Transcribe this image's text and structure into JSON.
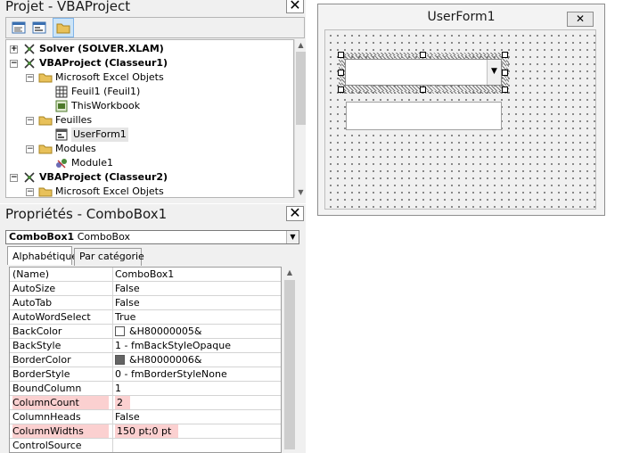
{
  "project_explorer": {
    "title": "Projet - VBAProject",
    "tree": [
      {
        "label": "Solver (SOLVER.XLAM)",
        "level": 0,
        "expander": "+",
        "icon": "vba-project-icon",
        "bold": true
      },
      {
        "label": "VBAProject (Classeur1)",
        "level": 0,
        "expander": "−",
        "icon": "vba-project-icon",
        "bold": true
      },
      {
        "label": "Microsoft Excel Objets",
        "level": 1,
        "expander": "−",
        "icon": "folder-icon",
        "bold": false
      },
      {
        "label": "Feuil1 (Feuil1)",
        "level": 2,
        "expander": "",
        "icon": "sheet-icon",
        "bold": false
      },
      {
        "label": "ThisWorkbook",
        "level": 2,
        "expander": "",
        "icon": "workbook-icon",
        "bold": false
      },
      {
        "label": "Feuilles",
        "level": 1,
        "expander": "−",
        "icon": "folder-icon",
        "bold": false
      },
      {
        "label": "UserForm1",
        "level": 2,
        "expander": "",
        "icon": "userform-icon",
        "bold": false,
        "selected": true
      },
      {
        "label": "Modules",
        "level": 1,
        "expander": "−",
        "icon": "folder-icon",
        "bold": false
      },
      {
        "label": "Module1",
        "level": 2,
        "expander": "",
        "icon": "module-icon",
        "bold": false
      },
      {
        "label": "VBAProject (Classeur2)",
        "level": 0,
        "expander": "−",
        "icon": "vba-project-icon",
        "bold": true
      },
      {
        "label": "Microsoft Excel Objets",
        "level": 1,
        "expander": "−",
        "icon": "folder-icon",
        "bold": false
      }
    ]
  },
  "properties": {
    "title": "Propriétés - ComboBox1",
    "object_name": "ComboBox1",
    "object_type": "ComboBox",
    "tabs": [
      {
        "label": "Alphabétique",
        "active": true
      },
      {
        "label": "Par catégorie",
        "active": false
      }
    ],
    "rows": [
      {
        "name": "(Name)",
        "value": "ComboBox1",
        "swatch": null,
        "highlight": false
      },
      {
        "name": "AutoSize",
        "value": "False",
        "swatch": null,
        "highlight": false
      },
      {
        "name": "AutoTab",
        "value": "False",
        "swatch": null,
        "highlight": false
      },
      {
        "name": "AutoWordSelect",
        "value": "True",
        "swatch": null,
        "highlight": false
      },
      {
        "name": "BackColor",
        "value": "&H80000005&",
        "swatch": "#ffffff",
        "highlight": false
      },
      {
        "name": "BackStyle",
        "value": "1 - fmBackStyleOpaque",
        "swatch": null,
        "highlight": false
      },
      {
        "name": "BorderColor",
        "value": "&H80000006&",
        "swatch": "#646464",
        "highlight": false
      },
      {
        "name": "BorderStyle",
        "value": "0 - fmBorderStyleNone",
        "swatch": null,
        "highlight": false
      },
      {
        "name": "BoundColumn",
        "value": "1",
        "swatch": null,
        "highlight": false
      },
      {
        "name": "ColumnCount",
        "value": "2",
        "swatch": null,
        "highlight": true
      },
      {
        "name": "ColumnHeads",
        "value": "False",
        "swatch": null,
        "highlight": false
      },
      {
        "name": "ColumnWidths",
        "value": "150 pt;0 pt",
        "swatch": null,
        "highlight": true
      },
      {
        "name": "ControlSource",
        "value": "",
        "swatch": null,
        "highlight": false
      }
    ],
    "highlight_color": "#fbd0d0"
  },
  "userform": {
    "title": "UserForm1",
    "close_glyph": "✕"
  },
  "close_glyph": "✕"
}
